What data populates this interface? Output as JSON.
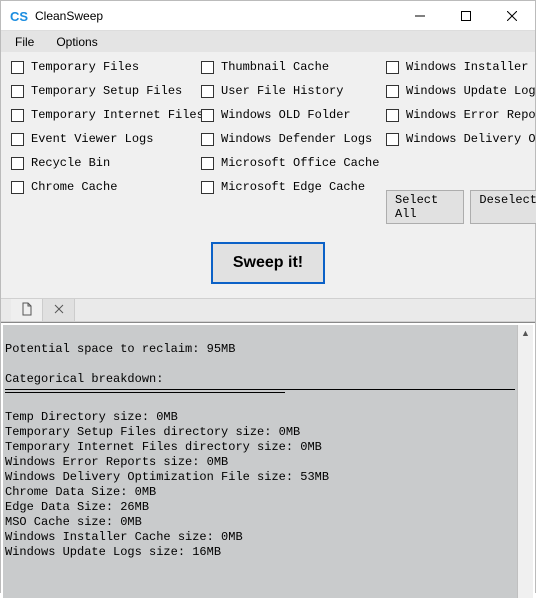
{
  "window": {
    "icon_text": "CS",
    "title": "CleanSweep"
  },
  "menu": {
    "file": "File",
    "options": "Options"
  },
  "checks": {
    "col0": [
      "Temporary Files",
      "Temporary Setup Files",
      "Temporary Internet Files",
      "Event Viewer Logs",
      "Recycle Bin",
      "Chrome Cache"
    ],
    "col1": [
      "Thumbnail Cache",
      "User File History",
      "Windows OLD Folder",
      "Windows Defender Logs",
      "Microsoft Office Cache",
      "Microsoft Edge Cache"
    ],
    "col2": [
      "Windows Installer Cache",
      "Windows Update Logs",
      "Windows Error Reports",
      "Windows Delivery Optimizat"
    ]
  },
  "buttons": {
    "select_all": "Select All",
    "deselect": "Deselect",
    "sweep": "Sweep it!"
  },
  "log": {
    "l0": "Potential space to reclaim: 95MB",
    "l1": "",
    "l2": "Categorical breakdown:",
    "l3": "Temp Directory size: 0MB",
    "l4": "Temporary Setup Files directory size: 0MB",
    "l5": "Temporary Internet Files directory size: 0MB",
    "l6": "Windows Error Reports size: 0MB",
    "l7": "Windows Delivery Optimization File size: 53MB",
    "l8": "Chrome Data Size: 0MB",
    "l9": "Edge Data Size: 26MB",
    "l10": "MSO Cache size: 0MB",
    "l11": "Windows Installer Cache size: 0MB",
    "l12": "Windows Update Logs size: 16MB"
  }
}
